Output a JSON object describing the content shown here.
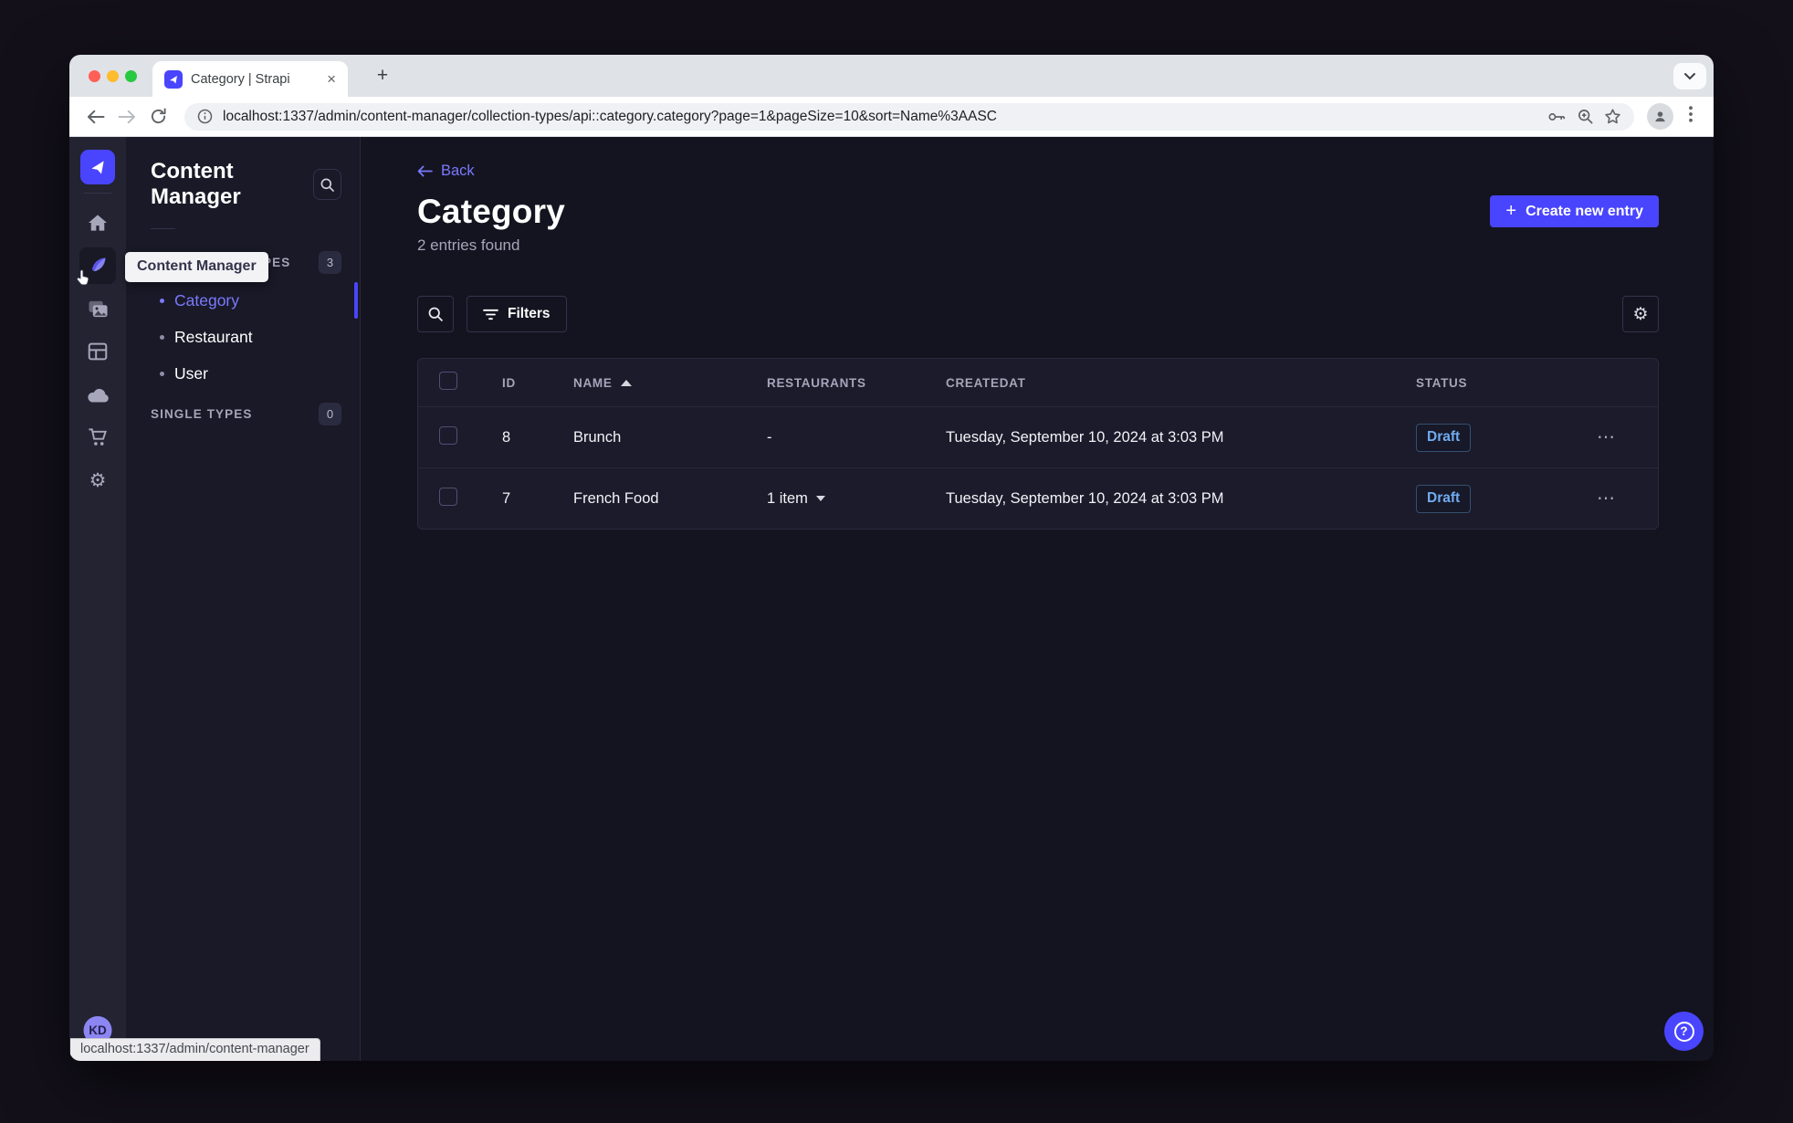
{
  "browser": {
    "tab_title": "Category | Strapi",
    "url": "localhost:1337/admin/content-manager/collection-types/api::category.category?page=1&pageSize=10&sort=Name%3AASC",
    "status_tooltip": "localhost:1337/admin/content-manager"
  },
  "rail": {
    "user_initials": "KD"
  },
  "subnav": {
    "title": "Content Manager",
    "tooltip": "Content Manager",
    "collection_types": {
      "label": "COLLECTION TYPES",
      "count": "3",
      "items": [
        {
          "label": "Category"
        },
        {
          "label": "Restaurant"
        },
        {
          "label": "User"
        }
      ]
    },
    "single_types": {
      "label": "SINGLE TYPES",
      "count": "0"
    }
  },
  "main": {
    "back": "Back",
    "title": "Category",
    "subtitle": "2 entries found",
    "create_button": "Create new entry",
    "filters": "Filters",
    "table": {
      "headers": {
        "id": "ID",
        "name": "NAME",
        "restaurants": "RESTAURANTS",
        "created": "CREATEDAT",
        "status": "STATUS"
      },
      "rows": [
        {
          "id": "8",
          "name": "Brunch",
          "restaurants": "-",
          "created": "Tuesday, September 10, 2024 at 3:03 PM",
          "status": "Draft"
        },
        {
          "id": "7",
          "name": "French Food",
          "restaurants": "1 item",
          "created": "Tuesday, September 10, 2024 at 3:03 PM",
          "status": "Draft"
        }
      ]
    }
  },
  "icons": {
    "plus": "+",
    "close": "×",
    "dots_vertical": "⋮",
    "ellipsis": "⋯",
    "gear": "⚙",
    "question": "?"
  },
  "colors": {
    "primary": "#4945ff",
    "primary_light": "#7b79ff",
    "draft_text": "#70acf0"
  }
}
